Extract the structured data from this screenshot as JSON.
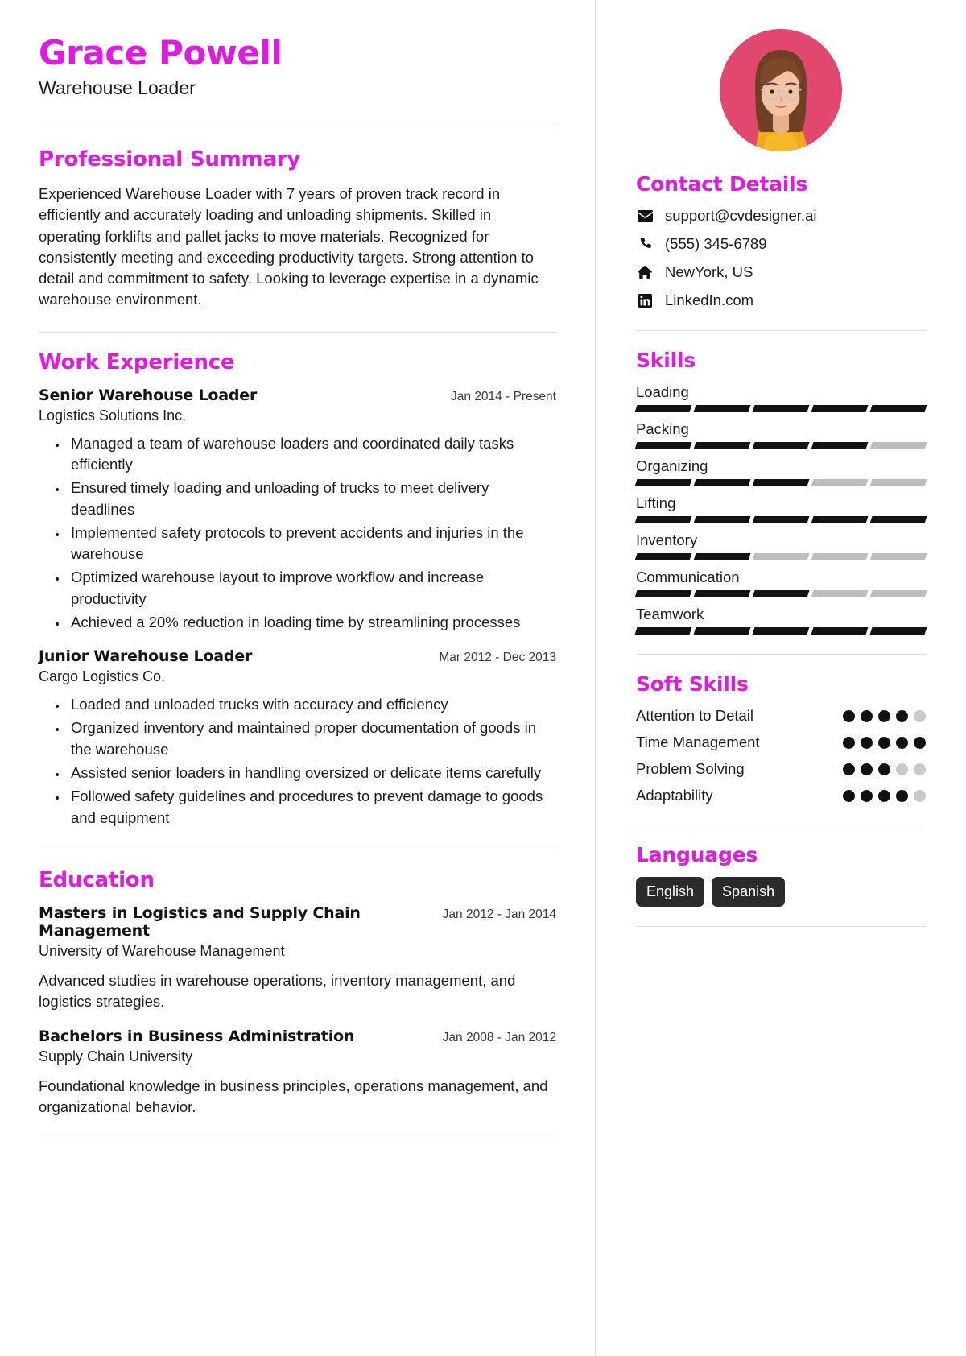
{
  "theme": {
    "accent": "#e319e3",
    "text": "#1d1d1d",
    "bar_on": "#121212",
    "bar_off": "#bdbdbd",
    "chip_bg": "#2b2b2b",
    "avatar_bg": "#e2486f"
  },
  "header": {
    "name": "Grace Powell",
    "job_title": "Warehouse Loader"
  },
  "summary": {
    "heading": "Professional Summary",
    "text": "Experienced Warehouse Loader with 7 years of proven track record in efficiently and accurately loading and unloading shipments. Skilled in operating forklifts and pallet jacks to move materials. Recognized for consistently meeting and exceeding productivity targets. Strong attention to detail and commitment to safety. Looking to leverage expertise in a dynamic warehouse environment."
  },
  "experience": {
    "heading": "Work Experience",
    "entries": [
      {
        "role": "Senior Warehouse Loader",
        "date": "Jan 2014 - Present",
        "org": "Logistics Solutions Inc.",
        "bullets": [
          "Managed a team of warehouse loaders and coordinated daily tasks efficiently",
          "Ensured timely loading and unloading of trucks to meet delivery deadlines",
          "Implemented safety protocols to prevent accidents and injuries in the warehouse",
          "Optimized warehouse layout to improve workflow and increase productivity",
          "Achieved a 20% reduction in loading time by streamlining processes"
        ]
      },
      {
        "role": "Junior Warehouse Loader",
        "date": "Mar 2012 - Dec 2013",
        "org": "Cargo Logistics Co.",
        "bullets": [
          "Loaded and unloaded trucks with accuracy and efficiency",
          "Organized inventory and maintained proper documentation of goods in the warehouse",
          "Assisted senior loaders in handling oversized or delicate items carefully",
          "Followed safety guidelines and procedures to prevent damage to goods and equipment"
        ]
      }
    ]
  },
  "education": {
    "heading": "Education",
    "entries": [
      {
        "degree": "Masters in Logistics and Supply Chain Management",
        "date": "Jan 2012 - Jan 2014",
        "school": "University of Warehouse Management",
        "description": "Advanced studies in warehouse operations, inventory management, and logistics strategies."
      },
      {
        "degree": "Bachelors in Business Administration",
        "date": "Jan 2008 - Jan 2012",
        "school": "Supply Chain University",
        "description": "Foundational knowledge in business principles, operations management, and organizational behavior."
      }
    ]
  },
  "contact": {
    "heading": "Contact Details",
    "items": [
      {
        "icon": "envelope-icon",
        "value": "support@cvdesigner.ai"
      },
      {
        "icon": "phone-icon",
        "value": "(555) 345-6789"
      },
      {
        "icon": "home-icon",
        "value": "NewYork, US"
      },
      {
        "icon": "linkedin-icon",
        "value": "LinkedIn.com"
      }
    ]
  },
  "skills": {
    "heading": "Skills",
    "max": 5,
    "items": [
      {
        "name": "Loading",
        "level": 5
      },
      {
        "name": "Packing",
        "level": 4
      },
      {
        "name": "Organizing",
        "level": 3
      },
      {
        "name": "Lifting",
        "level": 5
      },
      {
        "name": "Inventory",
        "level": 2
      },
      {
        "name": "Communication",
        "level": 3
      },
      {
        "name": "Teamwork",
        "level": 5
      }
    ]
  },
  "soft_skills": {
    "heading": "Soft Skills",
    "max": 5,
    "items": [
      {
        "name": "Attention to Detail",
        "level": 4
      },
      {
        "name": "Time Management",
        "level": 5
      },
      {
        "name": "Problem Solving",
        "level": 3
      },
      {
        "name": "Adaptability",
        "level": 4
      }
    ]
  },
  "languages": {
    "heading": "Languages",
    "items": [
      "English",
      "Spanish"
    ]
  }
}
